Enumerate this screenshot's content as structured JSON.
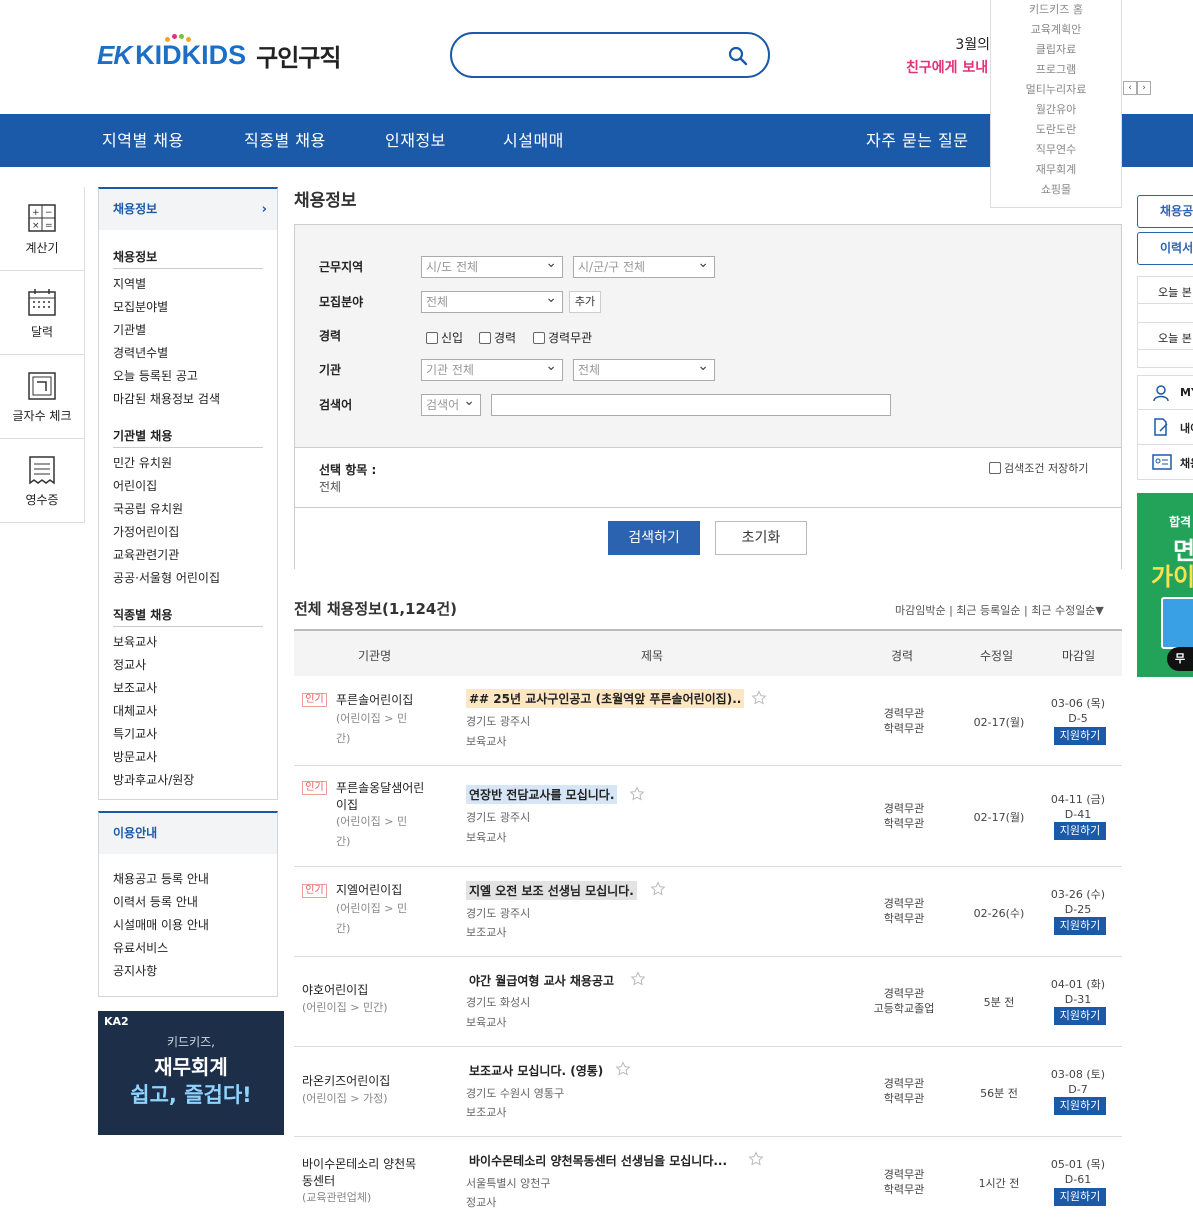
{
  "header": {
    "logo_ek": "EK",
    "logo_brand": "KIDKIDS",
    "logo_sub": "구인구직",
    "search_placeholder": "",
    "promo_line1": "3월의 ",
    "promo_line2": "친구에게 보내",
    "promo_prev": "‹",
    "promo_next": "›",
    "dropdown": [
      "키드키즈 홈",
      "교육계획안",
      "클립자료",
      "프로그램",
      "멀티누리자료",
      "월간유아",
      "도란도란",
      "직무연수",
      "재무회계",
      "쇼핑몰"
    ]
  },
  "nav": {
    "items": [
      "지역별 채용",
      "직종별 채용",
      "인재정보",
      "시설매매",
      "자주 묻는 질문"
    ]
  },
  "tools": [
    "계산기",
    "달력",
    "글자수 체크",
    "영수증"
  ],
  "sidebar": {
    "head": "채용정보",
    "chevron": "›",
    "groups": [
      {
        "title": "채용정보",
        "items": [
          "지역별",
          "모집분야별",
          "기관별",
          "경력년수별",
          "오늘 등록된 공고",
          "마감된 채용정보 검색"
        ]
      },
      {
        "title": "기관별 채용",
        "items": [
          "민간 유치원",
          "어린이집",
          "국공립 유치원",
          "가정어린이집",
          "교육관련기관",
          "공공·서울형 어린이집"
        ]
      },
      {
        "title": "직종별 채용",
        "items": [
          "보육교사",
          "정교사",
          "보조교사",
          "대체교사",
          "특기교사",
          "방문교사",
          "방과후교사/원장"
        ]
      }
    ]
  },
  "usage": {
    "head": "이용안내",
    "items": [
      "채용공고 등록 안내",
      "이력서 등록 안내",
      "시설매매 이용 안내",
      "유료서비스",
      "공지사항"
    ]
  },
  "banner": {
    "logo": "KA2",
    "line1": "키드키즈,",
    "line2": "재무회계",
    "line3": "쉽고, 즐겁다!"
  },
  "main": {
    "title": "채용정보"
  },
  "filter": {
    "region_label": "근무지역",
    "region_sido": "시/도 전체",
    "region_sigungu": "시/군/구 전체",
    "field_label": "모집분야",
    "field_value": "전체",
    "add_label": "추가",
    "career_label": "경력",
    "career_options": [
      "신입",
      "경력",
      "경력무관"
    ],
    "org_label": "기관",
    "org_value1": "기관 전체",
    "org_value2": "전체",
    "keyword_label": "검색어",
    "keyword_type": "검색어",
    "keyword_value": "",
    "selected_label": "선택 항목 :",
    "selected_value": "전체",
    "save_label": "검색조건 저장하기",
    "search_btn": "검색하기",
    "reset_btn": "초기화"
  },
  "list": {
    "title": "전체 채용정보(1,124건)",
    "sort": "마감임박순 | 최근 등록일순 | 최근 수정일순▼",
    "columns": [
      "기관명",
      "제목",
      "경력",
      "수정일",
      "마감일"
    ],
    "rows": [
      {
        "hot": "인기",
        "org": "푸른솔어린이집",
        "sub": "(어린이집 > 민간)",
        "title": "## 25년 교사구인공고 (초월역앞 푸른솔어린이집)..",
        "hl": "#fde6c2",
        "loc": "경기도 광주시",
        "cat": "보육교사",
        "career1": "경력무관",
        "career2": "학력무관",
        "mod": "02-17(월)",
        "date": "03-06 (목)",
        "dday": "D-5",
        "apply": "지원하기"
      },
      {
        "hot": "인기",
        "org": "푸른솔옹달샘어린이집",
        "sub": "(어린이집 > 민간)",
        "title": "연장반 전담교사를 모십니다.",
        "hl": "#d6e6f7",
        "loc": "경기도 광주시",
        "cat": "보육교사",
        "career1": "경력무관",
        "career2": "학력무관",
        "mod": "02-17(월)",
        "date": "04-11 (금)",
        "dday": "D-41",
        "apply": "지원하기"
      },
      {
        "hot": "인기",
        "org": "지엘어린이집",
        "sub": "(어린이집 > 민간)",
        "title": "지엘 오전 보조 선생님 모십니다.",
        "hl": "#e3e3e3",
        "loc": "경기도 광주시",
        "cat": "보조교사",
        "career1": "경력무관",
        "career2": "학력무관",
        "mod": "02-26(수)",
        "date": "03-26 (수)",
        "dday": "D-25",
        "apply": "지원하기"
      },
      {
        "hot": "",
        "org": "야호어린이집",
        "sub": "(어린이집 > 민간)",
        "title": "야간 월급여형 교사 채용공고",
        "hl": "",
        "loc": "경기도 화성시",
        "cat": "보육교사",
        "career1": "경력무관",
        "career2": "고등학교졸업",
        "mod": "5분 전",
        "date": "04-01 (화)",
        "dday": "D-31",
        "apply": "지원하기"
      },
      {
        "hot": "",
        "org": "라온키즈어린이집",
        "sub": "(어린이집 > 가정)",
        "title": "보조교사 모십니다. (영통)",
        "hl": "",
        "loc": "경기도 수원시 영통구",
        "cat": "보조교사",
        "career1": "경력무관",
        "career2": "학력무관",
        "mod": "56분 전",
        "date": "03-08 (토)",
        "dday": "D-7",
        "apply": "지원하기"
      },
      {
        "hot": "",
        "org": "바이수몬테소리 양천목동센터",
        "sub": "(교육관련업체)",
        "title": "바이수몬테소리 양천목동센터 선생님을 모십니다...",
        "hl": "",
        "loc": "서울특별시 양천구",
        "cat": "정교사",
        "career1": "경력무관",
        "career2": "학력무관",
        "mod": "1시간 전",
        "date": "05-01 (목)",
        "dday": "D-61",
        "apply": "지원하기"
      }
    ]
  },
  "right": {
    "btn1": "채용공고",
    "btn2": "이력서",
    "today1": "오늘 본",
    "today2": "오늘 본",
    "link1": "MY",
    "link2": "내이",
    "link3": "채용",
    "gbanner1": "합격",
    "gbanner2": "면",
    "gbanner3": "가이",
    "gbanner4": "무"
  },
  "colors": {
    "primary": "#1b5aa8",
    "accent": "#e2327a",
    "hot": "#e85c5c"
  }
}
